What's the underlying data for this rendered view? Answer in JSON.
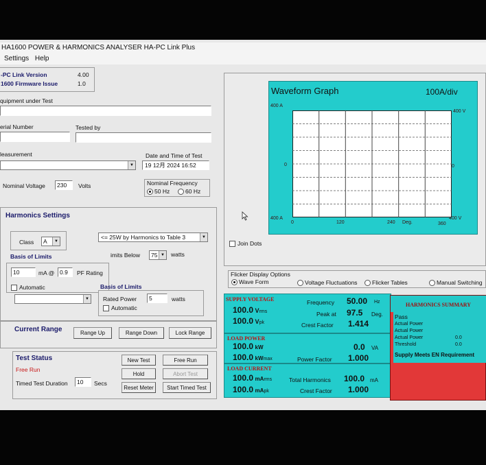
{
  "window": {
    "title": "HA1600 POWER & HARMONICS ANALYSER HA-PC Link Plus"
  },
  "menu": {
    "settings": "Settings",
    "help": "Help"
  },
  "versions": {
    "pc_link_label": "-PC Link Version",
    "pc_link_value": "4.00",
    "firmware_label": "1600 Firmware Issue",
    "firmware_value": "1.0"
  },
  "equipment": {
    "label": "quipment under Test",
    "value": ""
  },
  "serial": {
    "label": "erial Number",
    "value": ""
  },
  "tested_by": {
    "label": "Tested by",
    "value": ""
  },
  "measurement": {
    "label": "leasurement",
    "value": ""
  },
  "datetime": {
    "label": "Date and Time of Test",
    "value": "19 12月 2024 16:52"
  },
  "nominal_voltage": {
    "label": "Nominal Voltage",
    "value": "230",
    "unit": "Volts"
  },
  "nominal_frequency": {
    "label": "Nominal Frequency",
    "opt50": "50 Hz",
    "opt60": "60 Hz",
    "selected": "50 Hz"
  },
  "harmonics_settings": {
    "title": "Harmonics Settings",
    "class_label": "Class",
    "class_value": "A",
    "table_value": "<= 25W  by Harmonics to Table 3",
    "basis_label": "Basis of Limits",
    "limits_below_label": "imits Below",
    "limits_below_value": "75",
    "limits_below_unit": "watts",
    "ma_value": "10",
    "ma_label": "mA @",
    "pf_value": "0.9",
    "pf_label": "PF Rating",
    "automatic_label": "Automatic",
    "basis2_label": "Basis of Limits",
    "hidden_dd_value": "",
    "rated_power_label": "Rated Power",
    "rated_power_value": "5",
    "rated_power_unit": "watts",
    "automatic2_label": "Automatic"
  },
  "current_range": {
    "title": "Current Range",
    "up": "Range Up",
    "down": "Range Down",
    "lock": "Lock Range"
  },
  "test_status": {
    "title": "Test Status",
    "status": "Free Run",
    "new_test": "New Test",
    "free_run": "Free Run",
    "hold": "Hold",
    "abort": "Abort Test",
    "timed_label": "Timed Test Duration",
    "timed_value": "10",
    "timed_unit": "Secs",
    "reset_meter": "Reset Meter",
    "start_timed": "Start Timed Test"
  },
  "waveform": {
    "title": "Waveform Graph",
    "scale": "100A/div",
    "y_left_top": "400 A",
    "y_left_mid": "0",
    "y_left_bottom": "400 A",
    "y_right_top": "400 V",
    "y_right_mid": "0",
    "y_right_bottom": "400 V",
    "x_ticks": [
      "0",
      "120",
      "240",
      "360"
    ],
    "x_unit": "Deg."
  },
  "join_dots": "Join Dots",
  "flicker": {
    "title": "Flicker Display Options",
    "wave_form": "Wave Form",
    "voltage_fluct": "Voltage Fluctuations",
    "flicker_tables": "Flicker Tables",
    "manual_switching": "Manual Switching",
    "selected": "Wave Form"
  },
  "supply_voltage": {
    "title": "SUPPLY VOLTAGE",
    "v_rms": "100.0",
    "v_rms_unit": "V",
    "v_rms_sub": "rms",
    "v_pk": "100.0",
    "v_pk_unit": "V",
    "v_pk_sub": "pk",
    "freq_label": "Frequency",
    "freq_value": "50.00",
    "freq_unit": "Hz",
    "peak_label": "Peak at",
    "peak_value": "97.5",
    "peak_unit": "Deg.",
    "crest_label": "Crest Factor",
    "crest_value": "1.414"
  },
  "load_power": {
    "title": "LOAD POWER",
    "kw": "100.0",
    "kw_unit": "kW",
    "kw_max": "100.0",
    "kw_max_unit": "kW",
    "kw_max_sub": "max",
    "va": "0.0",
    "va_unit": "VA",
    "pf_label": "Power Factor",
    "pf_value": "1.000"
  },
  "load_current": {
    "title": "LOAD CURRENT",
    "ma_rms": "100.0",
    "ma_rms_unit": "mA",
    "ma_rms_sub": "rms",
    "ma_pk": "100.0",
    "ma_pk_unit": "mA",
    "ma_pk_sub": "pk",
    "total_h_label": "Total Harmonics",
    "total_h_value": "100.0",
    "total_h_unit": "mA",
    "crest_label": "Crest Factor",
    "crest_value": "1.000"
  },
  "harmonics_summary": {
    "title": "HARMONICS SUMMARY",
    "pass": "Pass",
    "actual_power_1": "Actual Power",
    "actual_power_2": "Actual Power",
    "actual_power_3": "Actual Power",
    "actual_power_3_value": "0.0",
    "threshold": "Threshold",
    "threshold_value": "0.0",
    "meets": "Supply Meets EN Requirement"
  },
  "colors": {
    "teal": "#23cccc",
    "red_panel": "#e23838",
    "red_text": "#c01010"
  }
}
